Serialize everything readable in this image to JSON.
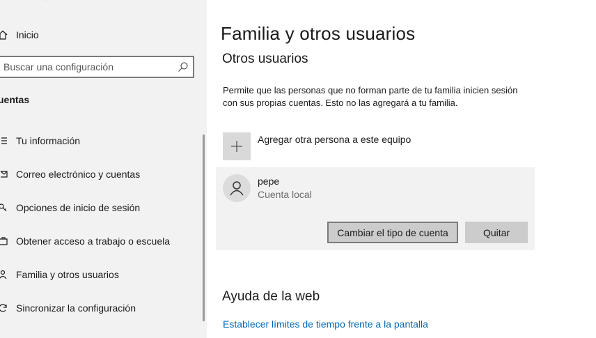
{
  "sidebar": {
    "home_label": "Inicio",
    "search_placeholder": "Buscar una configuración",
    "section_heading": "uentas",
    "items": [
      {
        "label": "Tu información",
        "icon": "person-card-icon"
      },
      {
        "label": "Correo electrónico y cuentas",
        "icon": "mail-icon"
      },
      {
        "label": "Opciones de inicio de sesión",
        "icon": "key-icon"
      },
      {
        "label": "Obtener acceso a trabajo o escuela",
        "icon": "briefcase-icon"
      },
      {
        "label": "Familia y otros usuarios",
        "icon": "people-icon"
      },
      {
        "label": "Sincronizar la configuración",
        "icon": "sync-icon"
      }
    ]
  },
  "main": {
    "title": "Familia y otros usuarios",
    "subtitle": "Otros usuarios",
    "description": "Permite que las personas que no forman parte de tu familia inicien sesión con sus propias cuentas. Esto no las agregará a tu familia.",
    "add_label": "Agregar otra persona a este equipo",
    "user": {
      "name": "pepe",
      "account_type": "Cuenta local",
      "change_button": "Cambiar el tipo de cuenta",
      "remove_button": "Quitar"
    },
    "help_title": "Ayuda de la web",
    "help_link": "Establecer límites de tiempo frente a la pantalla"
  },
  "colors": {
    "sidebar_bg": "#f2f2f2",
    "link": "#0067b8",
    "button_bg": "#cccccc"
  }
}
